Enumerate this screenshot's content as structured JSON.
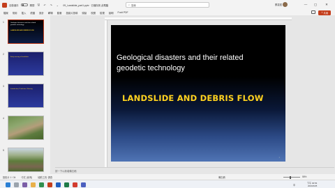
{
  "titlebar": {
    "autosave_label": "自動儲存",
    "autosave_state": "關閉",
    "filename": "09_Landslide_part1.pptx · 已儲存到 此電腦",
    "search_placeholder": "搜尋",
    "user_name": "蔡嘉宏",
    "window_controls": [
      "—",
      "▢",
      "✕"
    ]
  },
  "ribbon": {
    "tabs": [
      "檔案",
      "常用",
      "插入",
      "繪圖",
      "設計",
      "轉場",
      "動畫",
      "投影片放映",
      "錄製",
      "校閱",
      "檢視",
      "說明",
      "Foxit PDF"
    ],
    "share_label": "共用"
  },
  "thumbnails": [
    {
      "number": "1",
      "title": "Geological disasters and their related geodetic technology",
      "subtitle": "LANDSLIDE AND DEBRIS FLOW"
    },
    {
      "number": "2",
      "title": "Early warning of landslides",
      "subtitle": ""
    },
    {
      "number": "3",
      "title": "Introduction, Prediction, Warning",
      "subtitle": ""
    },
    {
      "number": "4",
      "title": "",
      "subtitle": ""
    },
    {
      "number": "5",
      "title": "",
      "subtitle": ""
    }
  ],
  "slide": {
    "title": "Geological disasters and their related geodetic technology",
    "subtitle": "LANDSLIDE AND DEBRIS FLOW",
    "page_number": "1"
  },
  "notes": {
    "placeholder": "按一下以新增備忘稿"
  },
  "status": {
    "slide_counter": "投影片 1 / 34",
    "language": "中文 (臺灣)",
    "accessibility": "協助工具: 調查",
    "notes_button": "備忘稿",
    "zoom": "58%"
  },
  "taskbar": {
    "time": "下午 04:54",
    "date": "2023/4/25",
    "language": "中"
  },
  "colors": {
    "accent": "#c43e1c",
    "slide_subtitle": "#ffd21f"
  }
}
